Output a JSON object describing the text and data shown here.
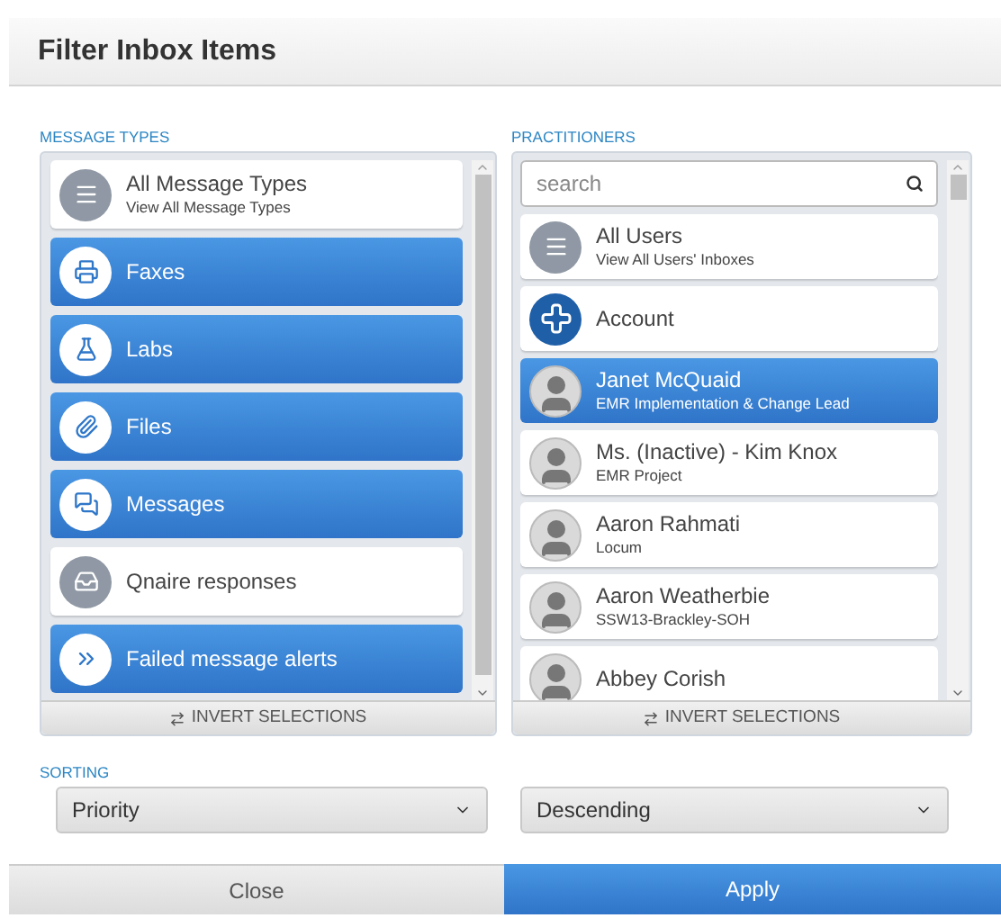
{
  "dialog": {
    "title": "Filter Inbox Items"
  },
  "message_types": {
    "label": "MESSAGE TYPES",
    "items": [
      {
        "kind": "all",
        "label": "All Message Types",
        "sublabel": "View All Message Types",
        "selected": false
      },
      {
        "kind": "fax",
        "label": "Faxes",
        "selected": true
      },
      {
        "kind": "lab",
        "label": "Labs",
        "selected": true
      },
      {
        "kind": "file",
        "label": "Files",
        "selected": true
      },
      {
        "kind": "message",
        "label": "Messages",
        "selected": true
      },
      {
        "kind": "qnaire",
        "label": "Qnaire responses",
        "selected": false
      },
      {
        "kind": "failed",
        "label": "Failed message alerts",
        "selected": true
      }
    ],
    "invert_button": "INVERT SELECTIONS"
  },
  "practitioners": {
    "label": "PRACTITIONERS",
    "search": {
      "placeholder": "search"
    },
    "items": [
      {
        "kind": "all",
        "label": "All Users",
        "sublabel": "View All Users' Inboxes",
        "selected": false
      },
      {
        "kind": "account",
        "label": "Account",
        "selected": false
      },
      {
        "kind": "user",
        "label": "Janet McQuaid",
        "sublabel": "EMR Implementation & Change Lead",
        "selected": true
      },
      {
        "kind": "user",
        "label": "Ms. (Inactive) - Kim Knox",
        "sublabel": "EMR Project",
        "selected": false
      },
      {
        "kind": "user",
        "label": "Aaron Rahmati",
        "sublabel": "Locum",
        "selected": false
      },
      {
        "kind": "user",
        "label": "Aaron Weatherbie",
        "sublabel": "SSW13-Brackley-SOH",
        "selected": false
      },
      {
        "kind": "user",
        "label": "Abbey Corish",
        "selected": false
      }
    ],
    "invert_button": "INVERT SELECTIONS"
  },
  "sorting": {
    "label": "SORTING",
    "field": "Priority",
    "order": "Descending"
  },
  "footer": {
    "close": "Close",
    "apply": "Apply"
  }
}
